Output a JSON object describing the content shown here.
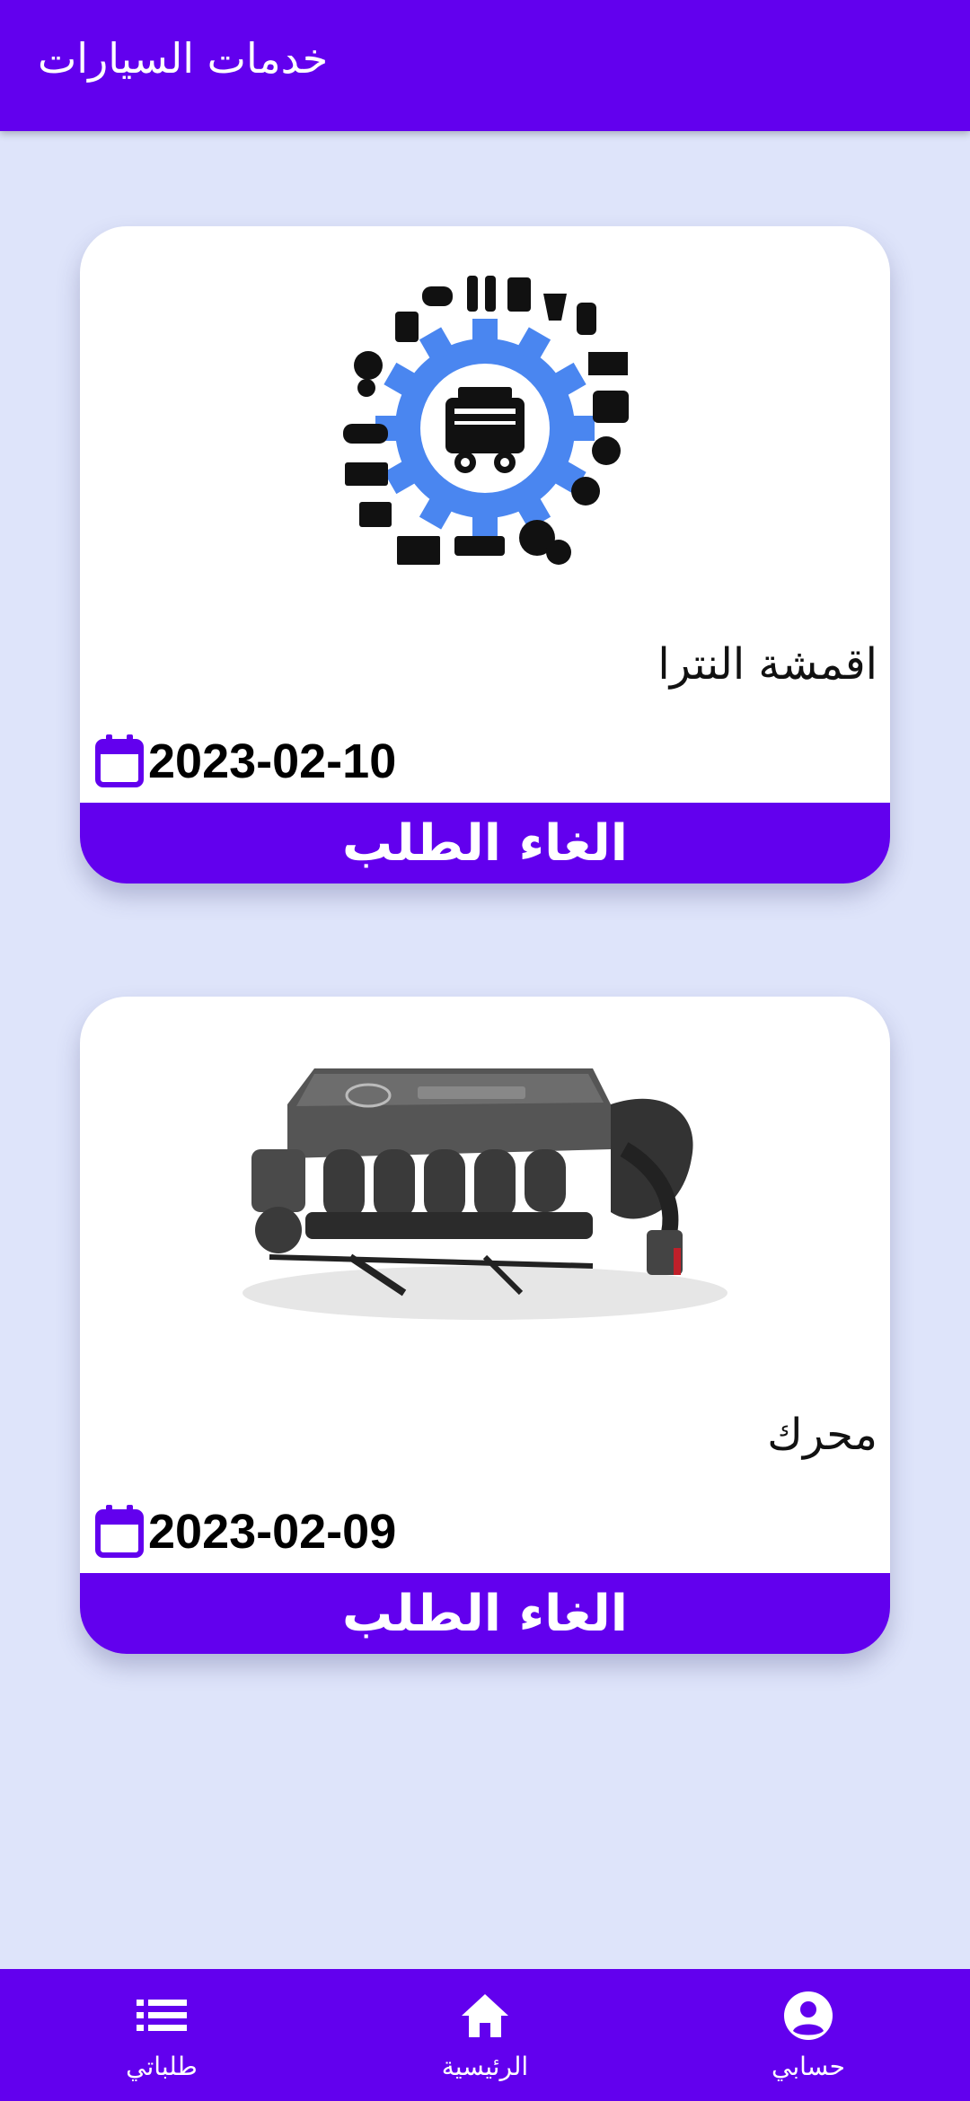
{
  "appbar": {
    "title": "خدمات السيارات"
  },
  "orders": [
    {
      "title": "اقمشة النترا",
      "date": "2023-02-10",
      "cancel_label": "الغاء الطلب",
      "image_icon": "auto-parts-gear-illustration"
    },
    {
      "title": "محرك",
      "date": "2023-02-09",
      "cancel_label": "الغاء الطلب",
      "image_icon": "car-engine-photo"
    }
  ],
  "nav": {
    "my_orders": {
      "label": "طلباتي",
      "icon": "list-icon"
    },
    "home": {
      "label": "الرئيسية",
      "icon": "home-icon"
    },
    "account": {
      "label": "حسابي",
      "icon": "account-circle-icon"
    }
  },
  "colors": {
    "primary": "#6200ee",
    "background": "#dee4fa",
    "gear": "#4a86f0"
  }
}
